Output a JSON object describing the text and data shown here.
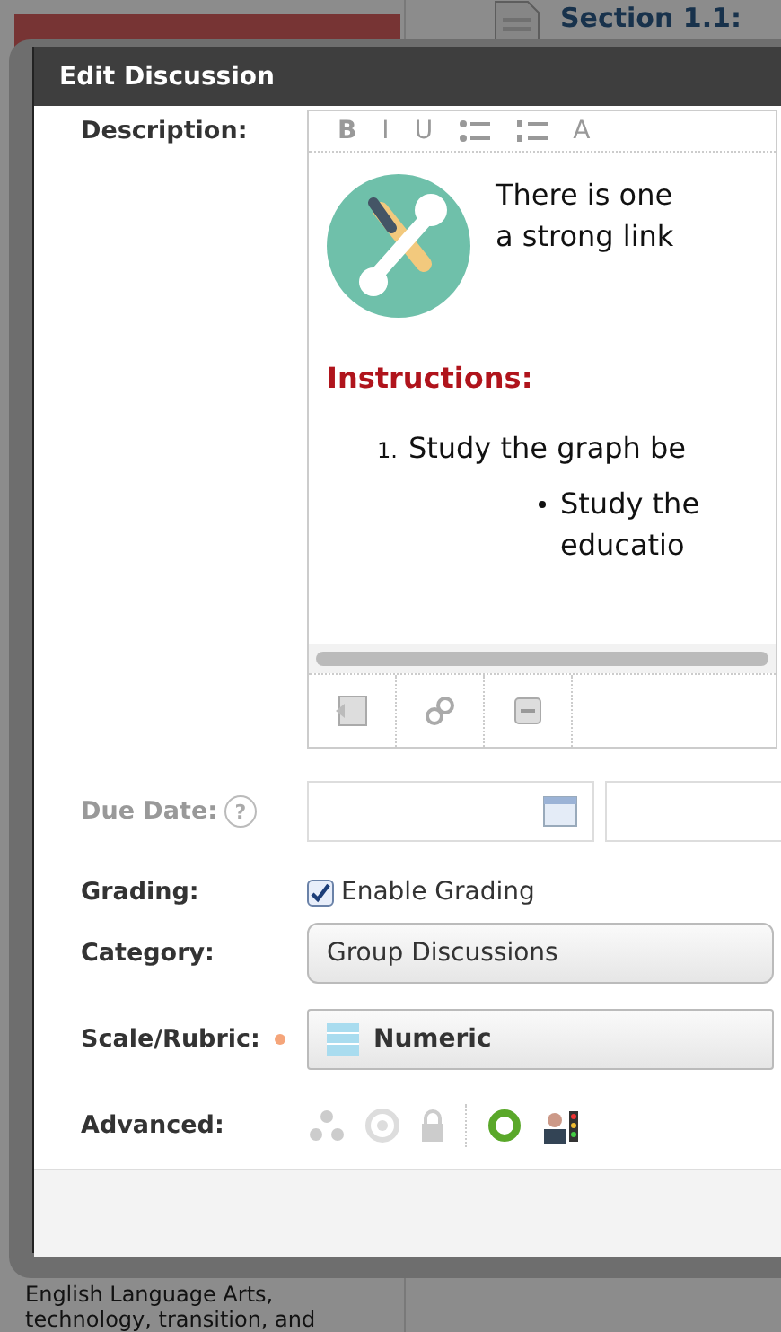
{
  "background": {
    "header_text": "Section 1.1:",
    "body_lines": [
      "English Language Arts,",
      "technology, transition, and"
    ]
  },
  "dialog": {
    "title": "Edit Discussion",
    "description": {
      "label": "Description:",
      "toolbar": [
        {
          "kind": "text",
          "label": "B"
        },
        {
          "kind": "text",
          "label": "I"
        },
        {
          "kind": "text",
          "label": "U"
        },
        {
          "kind": "bullet-list"
        },
        {
          "kind": "numbered-list"
        },
        {
          "kind": "text",
          "label": "A"
        }
      ],
      "intro_lines": [
        "There is one",
        "a strong link"
      ],
      "heading": "Instructions:",
      "list_number": "1.",
      "list_item": "Study the graph be",
      "bullet_lines": [
        "Study the",
        "educatio"
      ],
      "bottom_tools": [
        {
          "kind": "image"
        },
        {
          "kind": "link"
        },
        {
          "kind": "embed"
        }
      ]
    },
    "due_date": {
      "label": "Due Date:",
      "help": "?",
      "disabled": true
    },
    "grading": {
      "label": "Grading:",
      "option_label": "Enable Grading",
      "checked": true
    },
    "category": {
      "label": "Category:",
      "value": "Group Discussions"
    },
    "scale": {
      "label": "Scale/Rubric:",
      "required": true,
      "value": "Numeric"
    },
    "advanced": {
      "label": "Advanced:"
    }
  }
}
